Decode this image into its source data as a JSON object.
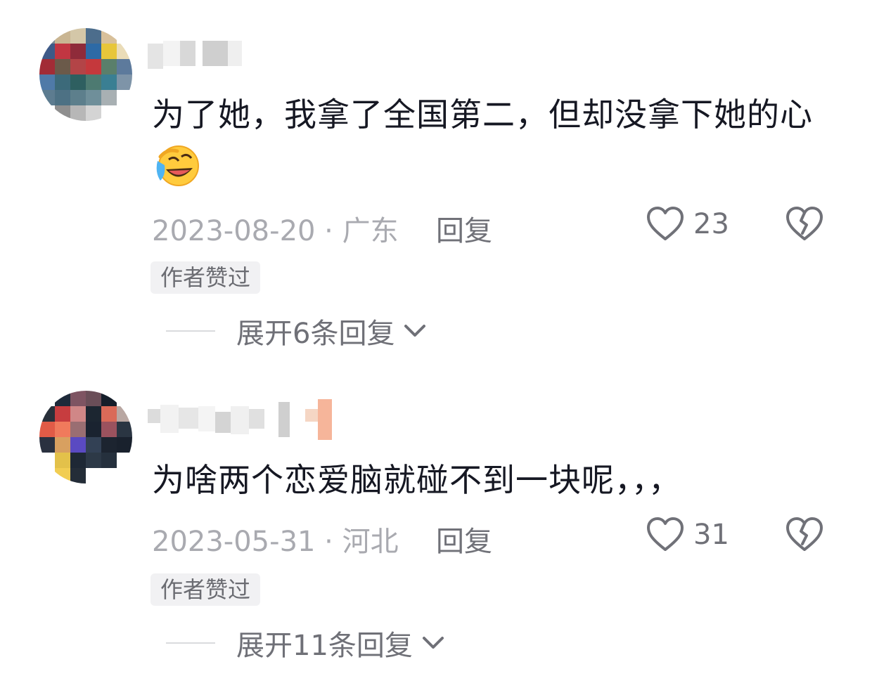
{
  "colors": {
    "text_primary": "#161823",
    "text_meta": "#a9aab0",
    "text_secondary": "#707178",
    "badge_bg": "#f1f1f3"
  },
  "comments": [
    {
      "text": "为了她，我拿了全国第二，但却没拿下她的心",
      "emoji": "laughing-with-tears-emoji",
      "date_location": "2023-08-20 · 广东",
      "reply_label": "回复",
      "like_count": "23",
      "author_badge": "作者赞过",
      "expand_label": "展开6条回复"
    },
    {
      "text": "为啥两个恋爱脑就碰不到一块呢，，，",
      "emoji": "",
      "date_location": "2023-05-31 · 河北",
      "reply_label": "回复",
      "like_count": "31",
      "author_badge": "作者赞过",
      "expand_label": "展开11条回复"
    }
  ]
}
